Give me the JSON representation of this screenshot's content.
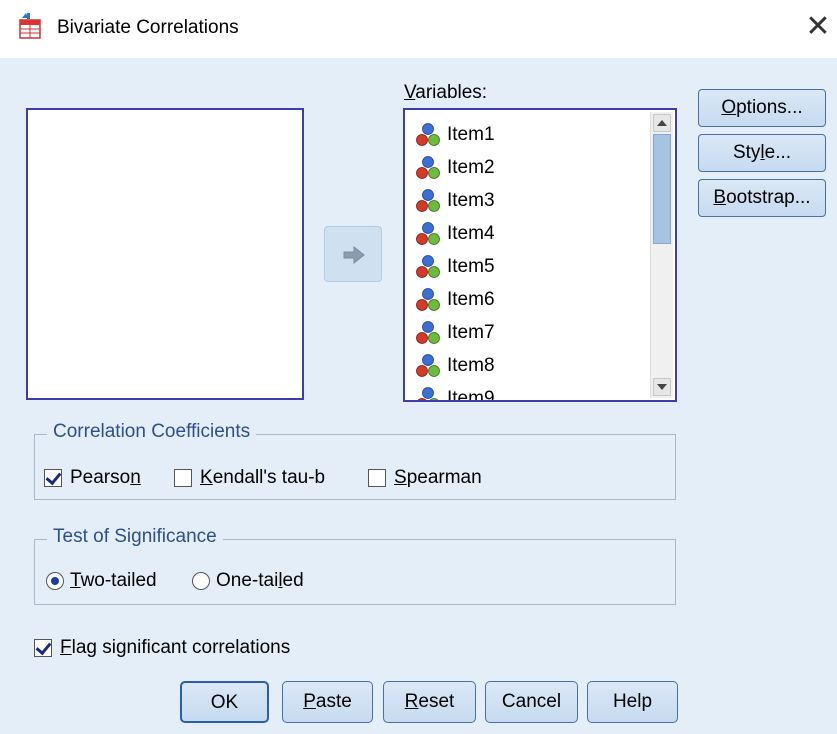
{
  "window": {
    "title": "Bivariate Correlations",
    "close_label": "✕"
  },
  "source_list": {
    "items": []
  },
  "variables": {
    "label": "Variables:",
    "items": [
      "Item1",
      "Item2",
      "Item3",
      "Item4",
      "Item5",
      "Item6",
      "Item7",
      "Item8",
      "Item9"
    ]
  },
  "side_buttons": {
    "options": "Options...",
    "style": "Style...",
    "bootstrap": "Bootstrap..."
  },
  "correlation_coefficients": {
    "title": "Correlation Coefficients",
    "pearson": {
      "label": "Pearson",
      "checked": true
    },
    "kendall": {
      "label": "Kendall's tau-b",
      "checked": false
    },
    "spearman": {
      "label": "Spearman",
      "checked": false
    }
  },
  "test_of_significance": {
    "title": "Test of Significance",
    "two_tailed": {
      "label": "Two-tailed",
      "selected": true
    },
    "one_tailed": {
      "label": "One-tailed",
      "selected": false
    }
  },
  "flag": {
    "label": "Flag significant correlations",
    "checked": true
  },
  "buttons": {
    "ok": "OK",
    "paste": "Paste",
    "reset": "Reset",
    "cancel": "Cancel",
    "help": "Help"
  },
  "icons": {
    "app": "spss-table-icon",
    "move": "move-right-arrow-icon",
    "variable": "scale-variable-icon"
  },
  "colors": {
    "client_bg": "#e3eef9",
    "list_border": "#3d3dad",
    "group_title": "#2f4f86"
  }
}
